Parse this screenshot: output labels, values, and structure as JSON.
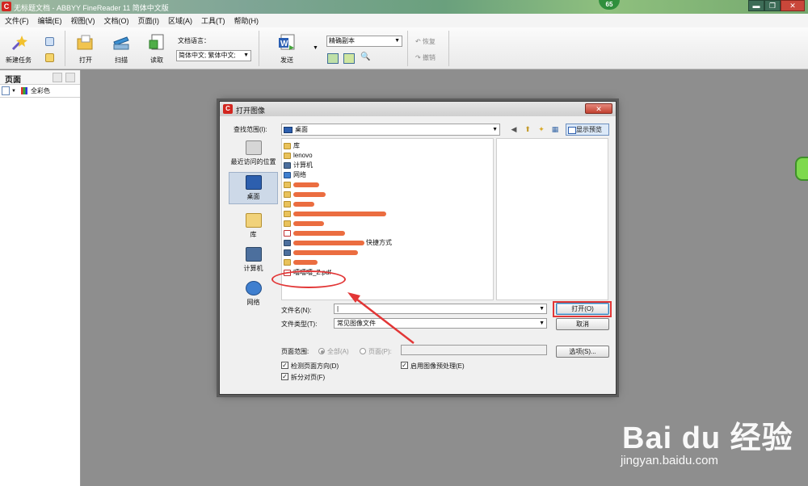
{
  "window": {
    "title": "无标题文档 - ABBYY FineReader 11 简体中文版",
    "notification_count": "65",
    "minimize": "▬",
    "restore": "❐",
    "close": "✕"
  },
  "menu": [
    "文件(F)",
    "编辑(E)",
    "视图(V)",
    "文档(O)",
    "页面(I)",
    "区域(A)",
    "工具(T)",
    "帮助(H)"
  ],
  "toolbar": {
    "new_task": "新建任务",
    "open": "打开",
    "scan": "扫描",
    "read": "读取",
    "doc_language_label": "文档语言：",
    "doc_language_value": "简体中文; 繁体中文;",
    "send": "发送",
    "mode_value": "精确副本",
    "undo": "恢复",
    "redo": "撤销"
  },
  "left_panel": {
    "title": "页面",
    "color_mode": "全彩色"
  },
  "dialog": {
    "title": "打开图像",
    "close": "✕",
    "look_in_label": "查找范围(I):",
    "look_in_value": "桌面",
    "preview_button": "显示预览",
    "places": [
      "最近访问的位置",
      "桌面",
      "库",
      "计算机",
      "网络"
    ],
    "files": [
      {
        "name": "库",
        "type": "folder"
      },
      {
        "name": "lenovo",
        "type": "folder"
      },
      {
        "name": "计算机",
        "type": "pc"
      },
      {
        "name": "网络",
        "type": "net"
      },
      {
        "name": "",
        "type": "folder"
      },
      {
        "name": "",
        "type": "folder"
      },
      {
        "name": "",
        "type": "folder"
      },
      {
        "name": "",
        "type": "folder"
      },
      {
        "name": "",
        "type": "folder"
      },
      {
        "name": "",
        "type": "pdf"
      },
      {
        "name": "快捷方式",
        "type": "pc"
      },
      {
        "name": "",
        "type": "pc"
      },
      {
        "name": "",
        "type": "folder"
      },
      {
        "name": "嘻嘻嘻_Z.pdf",
        "type": "pdf"
      }
    ],
    "filename_label": "文件名(N):",
    "filename_value": "|",
    "filetype_label": "文件类型(T):",
    "filetype_value": "常见图像文件",
    "open_button": "打开(O)",
    "cancel_button": "取消",
    "page_range_label": "页面范围:",
    "radio_all": "全部(A)",
    "radio_pages": "页面(P):",
    "options_button": "选项(S)...",
    "chk_detect_orientation": "检测页面方向(D)",
    "chk_split_pages": "拆分对页(F)",
    "chk_preprocess": "启用图像预处理(E)"
  },
  "watermark": {
    "brand": "Bai du 经验",
    "url": "jingyan.baidu.com"
  }
}
